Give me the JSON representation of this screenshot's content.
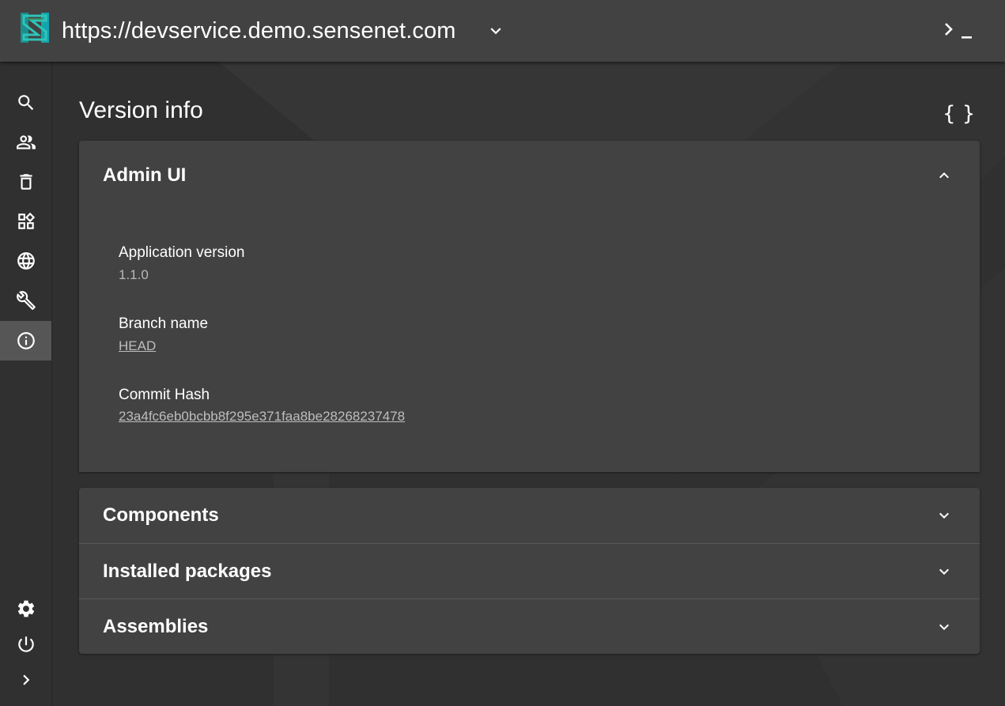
{
  "header": {
    "site_url": "https://devservice.demo.sensenet.com",
    "icons": {
      "logo": "sensenet-logo",
      "dropdown": "chevron-down-icon",
      "command": "command-palette-icon"
    }
  },
  "sidebar": {
    "items": [
      {
        "name": "search",
        "icon": "search-icon"
      },
      {
        "name": "users-and-groups",
        "icon": "people-icon"
      },
      {
        "name": "trash",
        "icon": "trash-icon"
      },
      {
        "name": "content-types",
        "icon": "widgets-icon"
      },
      {
        "name": "localization",
        "icon": "globe-icon"
      },
      {
        "name": "setup",
        "icon": "wrench-icon"
      },
      {
        "name": "version-info",
        "icon": "info-icon",
        "active": true
      }
    ],
    "bottom_items": [
      {
        "name": "settings",
        "icon": "gear-icon"
      },
      {
        "name": "logout",
        "icon": "power-icon"
      },
      {
        "name": "expand",
        "icon": "chevron-right-icon"
      }
    ]
  },
  "main": {
    "title": "Version info",
    "json_button": "{ }",
    "admin_ui": {
      "title": "Admin UI",
      "fields": [
        {
          "label": "Application version",
          "value": "1.1.0",
          "link": false
        },
        {
          "label": "Branch name",
          "value": "HEAD",
          "link": true
        },
        {
          "label": "Commit Hash",
          "value": "23a4fc6eb0bcbb8f295e371faa8be28268237478",
          "link": true
        }
      ]
    },
    "sections": [
      {
        "title": "Components"
      },
      {
        "title": "Installed packages"
      },
      {
        "title": "Assemblies"
      }
    ]
  },
  "colors": {
    "background": "#303030",
    "surface": "#424242",
    "active_nav": "#565656",
    "logo_primary": "#13a5ad",
    "logo_secondary": "#3d8b63"
  }
}
